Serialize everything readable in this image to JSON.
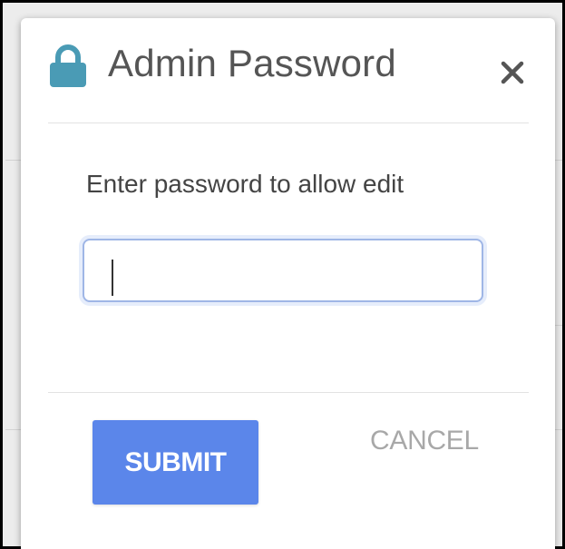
{
  "dialog": {
    "title": "Admin Password",
    "title_icon": "lock-icon",
    "close_icon": "close-icon",
    "prompt": "Enter password to allow edit",
    "password": {
      "value": "",
      "placeholder": ""
    },
    "buttons": {
      "submit_label": "SUBMIT",
      "cancel_label": "CANCEL"
    }
  },
  "colors": {
    "accent": "#5b86ea",
    "lock_icon": "#4a9bb5",
    "title_text": "#555555",
    "cancel_text": "#a8a8a8",
    "input_border": "#9fb6e6"
  }
}
